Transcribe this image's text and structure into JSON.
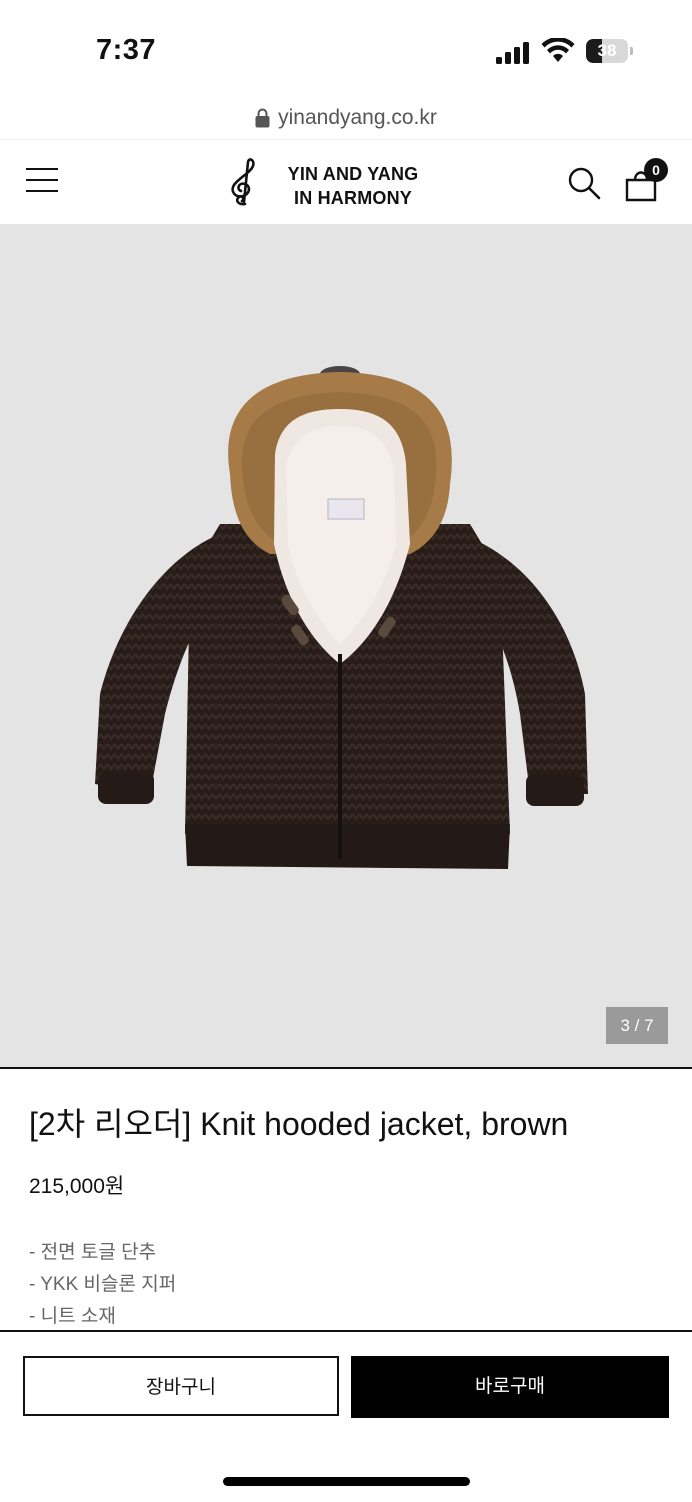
{
  "status_bar": {
    "time": "7:37",
    "battery": "38",
    "battery_level": 0.38
  },
  "browser": {
    "url": "yinandyang.co.kr"
  },
  "header": {
    "logo_line1": "YIN AND YANG",
    "logo_line2": "IN HARMONY",
    "cart_count": "0"
  },
  "gallery": {
    "pager": "3 / 7"
  },
  "product": {
    "title": "[2차 리오더] Knit hooded jacket, brown",
    "price": "215,000원",
    "details": [
      "- 전면 토글 단추",
      "- YKK 비슬론 지퍼",
      "- 니트 소재"
    ]
  },
  "actions": {
    "cart_label": "장바구니",
    "buy_label": "바로구매"
  },
  "colors": {
    "accent": "#000000",
    "gallery_bg": "#e4e4e4",
    "jacket": "#2a1e1a",
    "fur": "#a57a46"
  }
}
